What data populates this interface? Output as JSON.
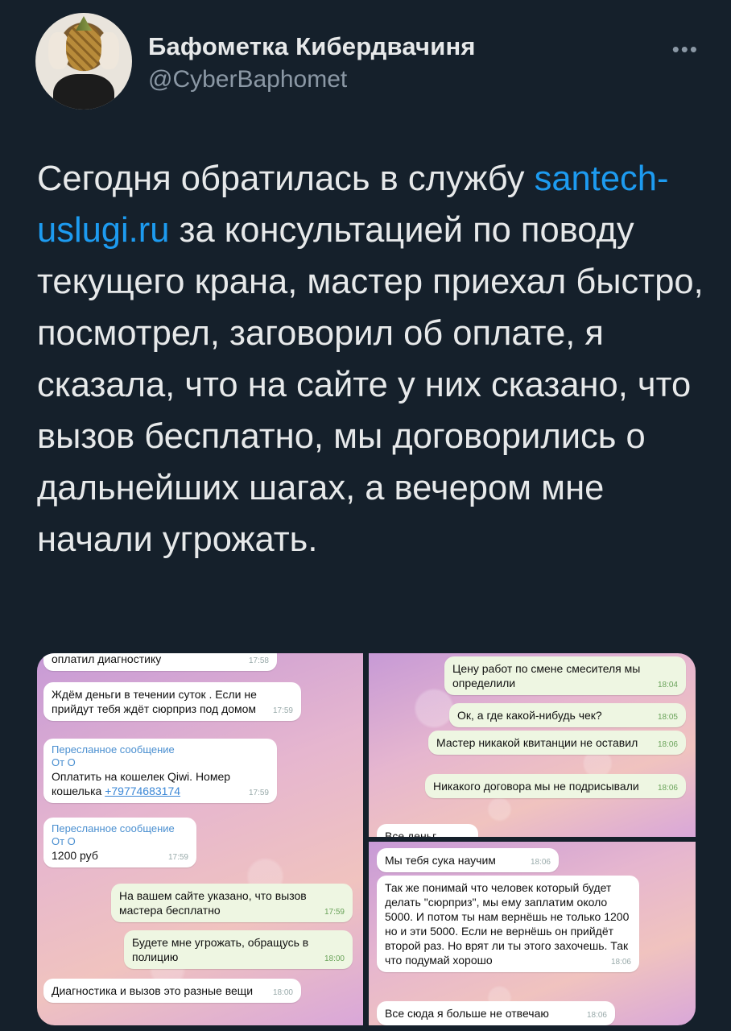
{
  "author": {
    "name": "Бафометка Кибердвачиня",
    "handle": "@CyberBaphomet",
    "more_icon": "more-horizontal-icon"
  },
  "tweet": {
    "text_before_link": "Сегодня обратилась в службу ",
    "link": "santech-uslugi.ru",
    "text_after_link": " за консультацией по поводу текущего крана, мастер приехал быстро, посмотрел, заговорил об оплате, я сказала, что на сайте у них сказано, что вызов бесплатно, мы договорились о дальнейших шагах, а вечером мне начали угрожать.",
    "link_color": "#1d9bf0"
  },
  "screens": {
    "left": [
      {
        "text": "оплатил диагностику",
        "time": "17:58",
        "type": "in"
      },
      {
        "text": "Ждём деньги в течении суток . Если не прийдут тебя ждёт сюрприз под домом",
        "time": "17:59",
        "type": "in"
      },
      {
        "forward": "Пересланное сообщение",
        "from": "От О",
        "text": "Оплатить на кошелек  Qiwi. Номер кошелька ",
        "phone": "+79774683174",
        "time": "17:59",
        "type": "in"
      },
      {
        "forward": "Пересланное сообщение",
        "from": "От О",
        "text": "1200 руб",
        "time": "17:59",
        "type": "in"
      },
      {
        "text": "На вашем сайте указано, что вызов мастера бесплатно",
        "time": "17:59",
        "type": "out"
      },
      {
        "text": "Будете мне угрожать, обращусь в полицию",
        "time": "18:00",
        "type": "out"
      },
      {
        "text": "Диагностика и вызов это разные вещи",
        "time": "18:00",
        "type": "in"
      }
    ],
    "top_right": [
      {
        "text": "Цену работ по смене смесителя мы определили",
        "time": "18:04",
        "type": "out"
      },
      {
        "text": "Ок, а где какой-нибудь чек?",
        "time": "18:05",
        "type": "out"
      },
      {
        "text": "Мастер никакой квитанции не оставил",
        "time": "18:06",
        "type": "out"
      },
      {
        "text": "Никакого договора мы не подрисывали",
        "time": "18:06",
        "type": "out"
      },
      {
        "text": "Все деньг",
        "time": "",
        "type": "in"
      }
    ],
    "bottom_right": [
      {
        "text": "Мы тебя сука научим",
        "time": "18:06",
        "type": "in"
      },
      {
        "text": "Так же понимай что человек который будет делать \"сюрприз\", мы ему заплатим около 5000. И потом ты нам вернёшь не только 1200 но и эти 5000. Если не вернёшь он прийдёт второй раз. Но врят ли ты этого захочешь. Так что подумай хорошо",
        "time": "18:06",
        "type": "in"
      },
      {
        "text": "Все сюда я больше не отвечаю",
        "time": "18:06",
        "type": "in"
      }
    ]
  }
}
